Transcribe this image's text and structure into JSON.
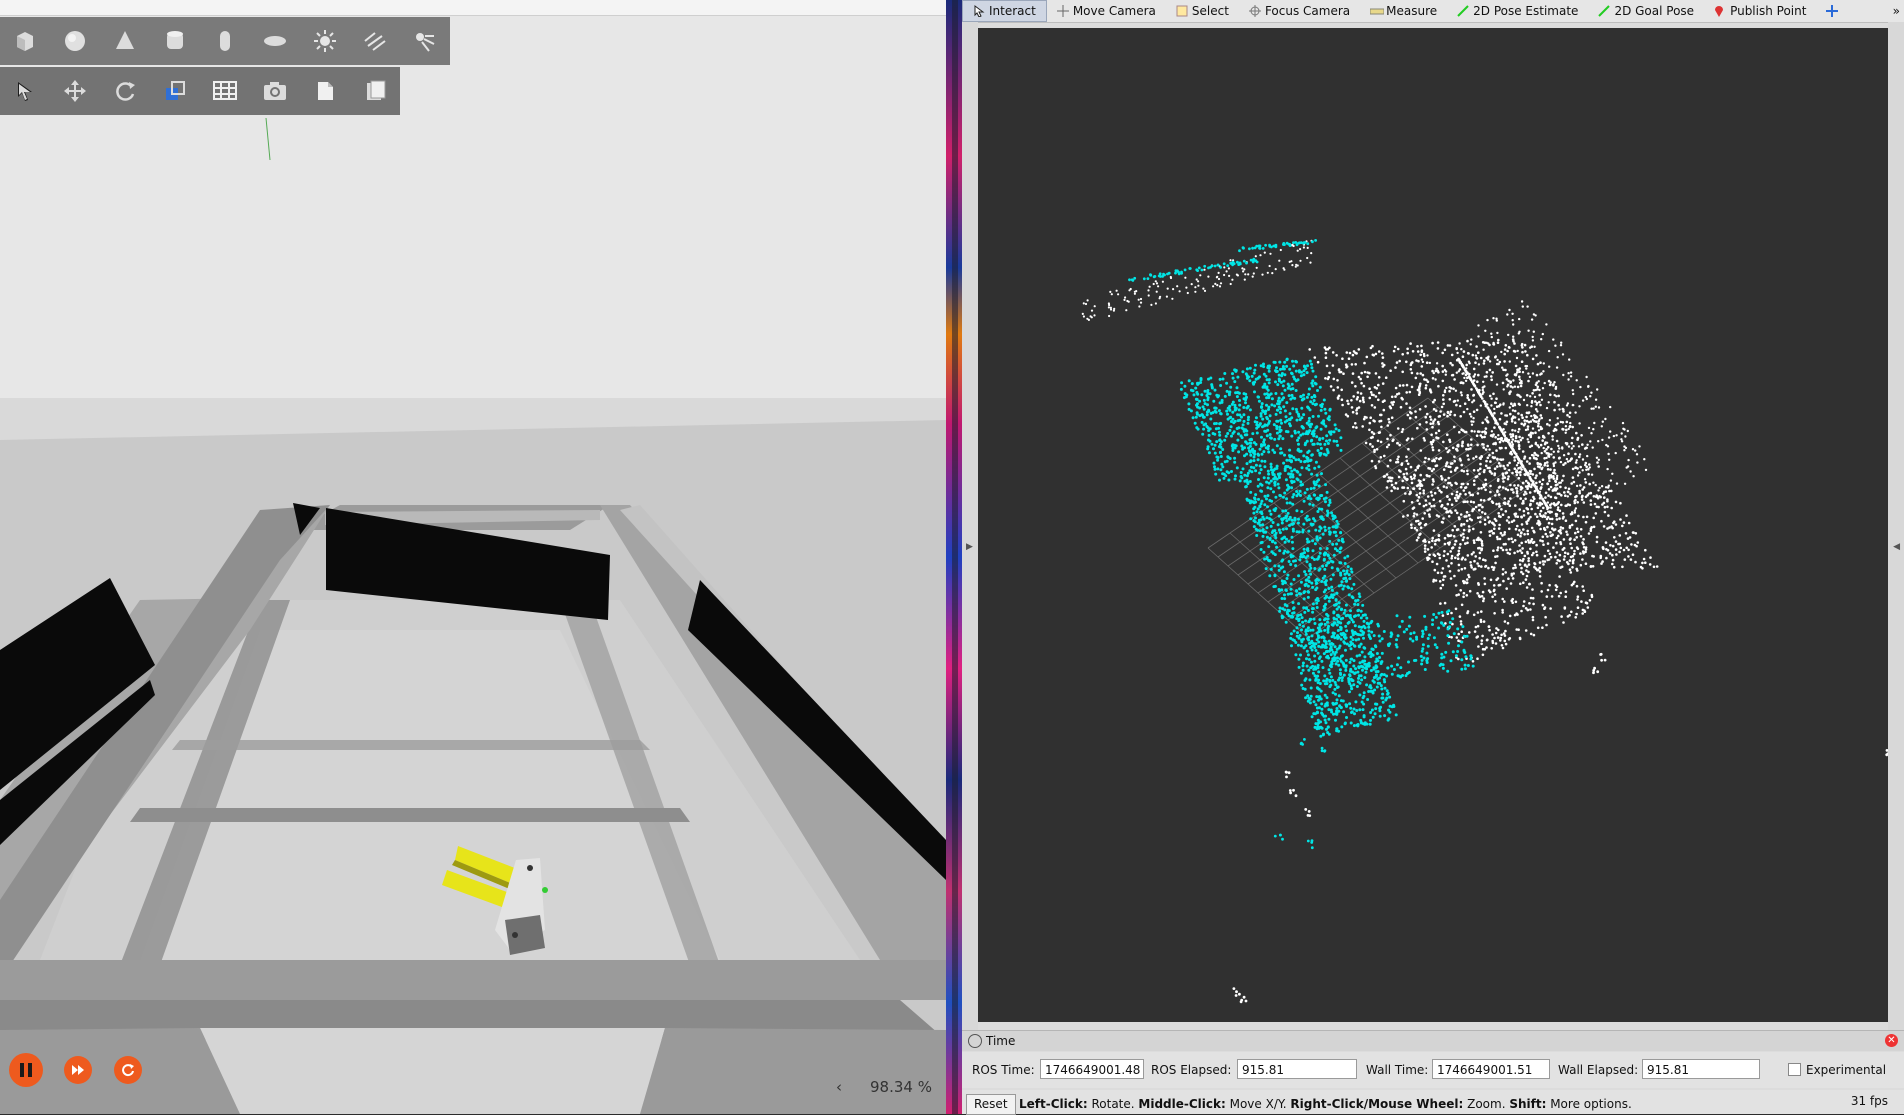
{
  "gazebo": {
    "toolbar_shapes": [
      "box-icon",
      "sphere-icon",
      "cone-icon",
      "cylinder-icon",
      "capsule-icon",
      "ellipsoid-icon",
      "sun-light-icon",
      "directional-light-icon",
      "spot-light-icon"
    ],
    "toolbar_tools": [
      "select-arrow-icon",
      "translate-icon",
      "rotate-icon",
      "scale-icon",
      "snap-grid-icon",
      "camera-icon",
      "copy-icon",
      "paste-icon"
    ],
    "real_time_factor": "98.34 %",
    "play_controls": [
      "pause-icon",
      "step-forward-icon",
      "reset-icon"
    ],
    "accent": "#ee5a1e"
  },
  "rviz": {
    "tools": [
      {
        "label": "Interact",
        "icon": "interact-icon",
        "active": true
      },
      {
        "label": "Move Camera",
        "icon": "move-camera-icon"
      },
      {
        "label": "Select",
        "icon": "select-icon"
      },
      {
        "label": "Focus Camera",
        "icon": "focus-camera-icon"
      },
      {
        "label": "Measure",
        "icon": "measure-icon"
      },
      {
        "label": "2D Pose Estimate",
        "icon": "pose-estimate-icon"
      },
      {
        "label": "2D Goal Pose",
        "icon": "goal-pose-icon"
      },
      {
        "label": "Publish Point",
        "icon": "publish-point-icon"
      }
    ],
    "overflow": "»",
    "cloud_colors": {
      "highlight": "#00e5e5",
      "points": "#ffffff",
      "background": "#303030"
    },
    "time_panel": {
      "title": "Time",
      "ros_time_label": "ROS Time:",
      "ros_time": "1746649001.48",
      "ros_elapsed_label": "ROS Elapsed:",
      "ros_elapsed": "915.81",
      "wall_time_label": "Wall Time:",
      "wall_time": "1746649001.51",
      "wall_elapsed_label": "Wall Elapsed:",
      "wall_elapsed": "915.81",
      "experimental_label": "Experimental"
    },
    "status": {
      "reset_label": "Reset",
      "hint_parts": [
        {
          "b": "Left-Click:",
          "t": " Rotate. "
        },
        {
          "b": "Middle-Click:",
          "t": " Move X/Y. "
        },
        {
          "b": "Right-Click/Mouse Wheel:",
          "t": " Zoom. "
        },
        {
          "b": "Shift:",
          "t": " More options."
        }
      ],
      "fps": "31 fps"
    }
  }
}
